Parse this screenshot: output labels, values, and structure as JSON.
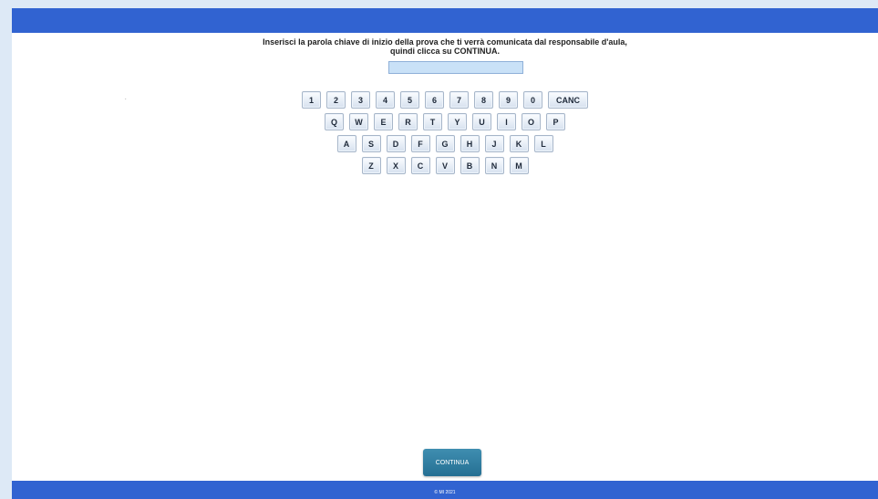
{
  "instructions": {
    "line1": "Inserisci la parola chiave di inizio della prova che ti verrà comunicata dal responsabile d'aula,",
    "line2": "quindi clicca su CONTINUA."
  },
  "keyword_input": {
    "value": "",
    "placeholder": ""
  },
  "keyboard": {
    "row1": [
      "1",
      "2",
      "3",
      "4",
      "5",
      "6",
      "7",
      "8",
      "9",
      "0",
      "CANC"
    ],
    "row2": [
      "Q",
      "W",
      "E",
      "R",
      "T",
      "Y",
      "U",
      "I",
      "O",
      "P"
    ],
    "row3": [
      "A",
      "S",
      "D",
      "F",
      "G",
      "H",
      "J",
      "K",
      "L"
    ],
    "row4": [
      "Z",
      "X",
      "C",
      "V",
      "B",
      "N",
      "M"
    ]
  },
  "continue_label": "CONTINUA",
  "footer": "© MI 2021",
  "colors": {
    "bar": "#3163d1",
    "button": "#2f7da3",
    "page_bg": "#dde9f6"
  }
}
